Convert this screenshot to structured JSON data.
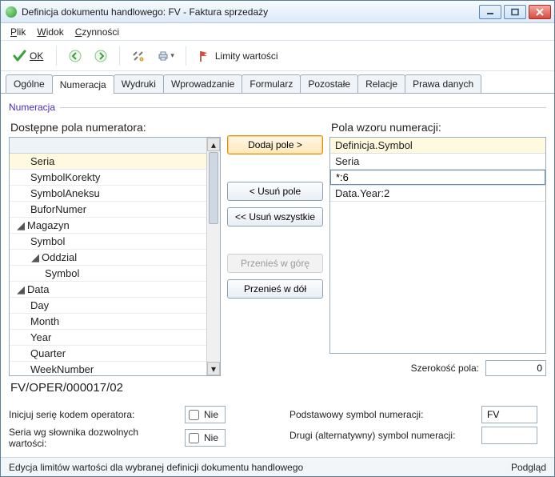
{
  "window": {
    "title": "Definicja dokumentu handlowego: FV - Faktura sprzedaży"
  },
  "menu": {
    "plik": "Plik",
    "widok": "Widok",
    "czynnosci": "Czynności"
  },
  "toolbar": {
    "ok": "OK",
    "limity": "Limity wartości"
  },
  "tabs": [
    "Ogólne",
    "Numeracja",
    "Wydruki",
    "Wprowadzanie",
    "Formularz",
    "Pozostałe",
    "Relacje",
    "Prawa danych"
  ],
  "activeTab": 1,
  "section": "Numeracja",
  "left": {
    "title": "Dostępne pola numeratora:",
    "items": [
      {
        "label": "Seria",
        "indent": 1,
        "selected": true
      },
      {
        "label": "SymbolKorekty",
        "indent": 1
      },
      {
        "label": "SymbolAneksu",
        "indent": 1
      },
      {
        "label": "BuforNumer",
        "indent": 1
      },
      {
        "label": "Magazyn",
        "indent": 0,
        "expander": "▢"
      },
      {
        "label": "Symbol",
        "indent": 1
      },
      {
        "label": "Oddzial",
        "indent": 1,
        "expander": "▢"
      },
      {
        "label": "Symbol",
        "indent": 2
      },
      {
        "label": "Data",
        "indent": 0,
        "expander": "▢"
      },
      {
        "label": "Day",
        "indent": 1
      },
      {
        "label": "Month",
        "indent": 1
      },
      {
        "label": "Year",
        "indent": 1
      },
      {
        "label": "Quarter",
        "indent": 1
      },
      {
        "label": "WeekNumber",
        "indent": 1
      }
    ]
  },
  "mid": {
    "add": "Dodaj pole >",
    "remove": "< Usuń pole",
    "removeAll": "<< Usuń wszystkie",
    "up": "Przenieś w górę",
    "down": "Przenieś w dół"
  },
  "right": {
    "title": "Pola wzoru numeracji:",
    "items": [
      "Definicja.Symbol",
      "Seria",
      "*:6",
      "Data.Year:2"
    ],
    "editValue": "*:6",
    "widthLabel": "Szerokość pola:",
    "widthValue": "0"
  },
  "preview": "FV/OPER/000017/02",
  "form": {
    "initLabel": "Inicjuj serię kodem operatora:",
    "initValue": "Nie",
    "dictLabel": "Seria wg słownika dozwolnych wartości:",
    "dictValue": "Nie",
    "primaryLabel": "Podstawowy symbol numeracji:",
    "primaryValue": "FV",
    "altLabel": "Drugi (alternatywny) symbol numeracji:",
    "altValue": ""
  },
  "status": {
    "left": "Edycja limitów wartości dla wybranej definicji dokumentu handlowego",
    "right": "Podgląd"
  }
}
